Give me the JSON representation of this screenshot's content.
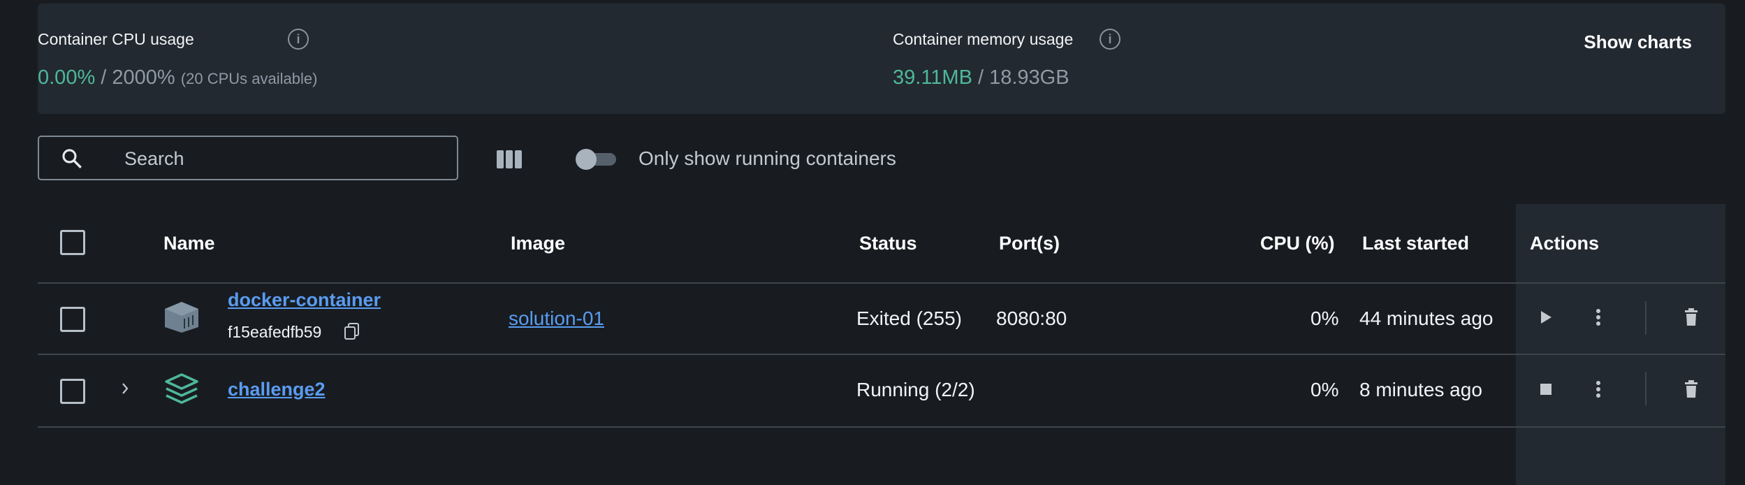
{
  "stats": {
    "cpu": {
      "label": "Container CPU usage",
      "used": "0.00%",
      "separator": " / ",
      "total": "2000%",
      "note": "(20 CPUs available)"
    },
    "memory": {
      "label": "Container memory usage",
      "used": "39.11MB",
      "separator": " / ",
      "total": "18.93GB"
    },
    "show_charts_label": "Show charts"
  },
  "toolbar": {
    "search_placeholder": "Search",
    "toggle_label": "Only show running containers",
    "toggle_on": false
  },
  "table": {
    "headers": {
      "name": "Name",
      "image": "Image",
      "status": "Status",
      "ports": "Port(s)",
      "cpu": "CPU (%)",
      "last_started": "Last started",
      "actions": "Actions"
    },
    "rows": [
      {
        "name": "docker-container",
        "id": "f15eafedfb59",
        "image": "solution-01",
        "status": "Exited (255)",
        "ports": "8080:80",
        "cpu": "0%",
        "last_started": "44 minutes ago"
      },
      {
        "name": "challenge2",
        "image": "",
        "status": "Running (2/2)",
        "ports": "",
        "cpu": "0%",
        "last_started": "8 minutes ago"
      }
    ]
  },
  "colors": {
    "background": "#181c21",
    "panel": "#222930",
    "accent_green": "#4fb89a",
    "link_blue": "#5a9cf0"
  },
  "icons": [
    "info-icon",
    "search-icon",
    "columns-icon",
    "container-icon",
    "stack-icon",
    "play-icon",
    "stop-icon",
    "more-vert-icon",
    "trash-icon",
    "copy-icon",
    "chevron-right-icon"
  ]
}
